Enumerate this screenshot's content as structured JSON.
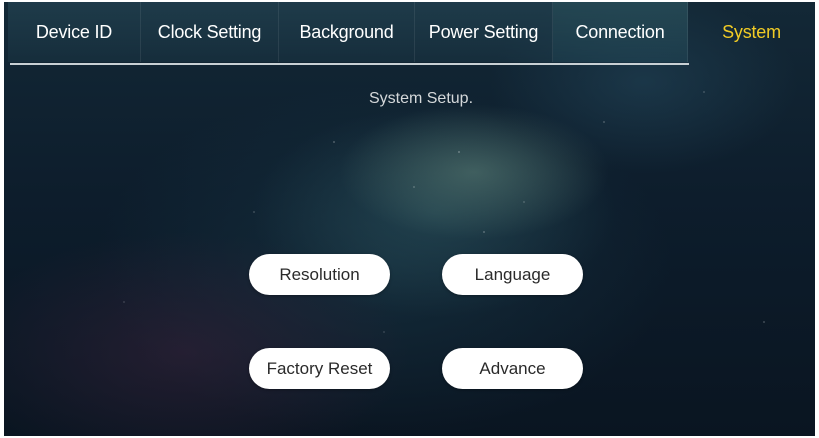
{
  "tabs": [
    {
      "label": "Device ID",
      "active": false
    },
    {
      "label": "Clock Setting",
      "active": false
    },
    {
      "label": "Background",
      "active": false
    },
    {
      "label": "Power Setting",
      "active": false
    },
    {
      "label": "Connection",
      "active": false
    },
    {
      "label": "System",
      "active": true
    }
  ],
  "section_title": "System Setup.",
  "buttons": {
    "resolution": "Resolution",
    "language": "Language",
    "factory_reset": "Factory Reset",
    "advance": "Advance"
  },
  "colors": {
    "active_tab": "#f2cc25",
    "tab_text": "#ffffff",
    "button_bg": "#ffffff",
    "button_text": "#2a2a2a",
    "background": "#0d1d2c"
  }
}
